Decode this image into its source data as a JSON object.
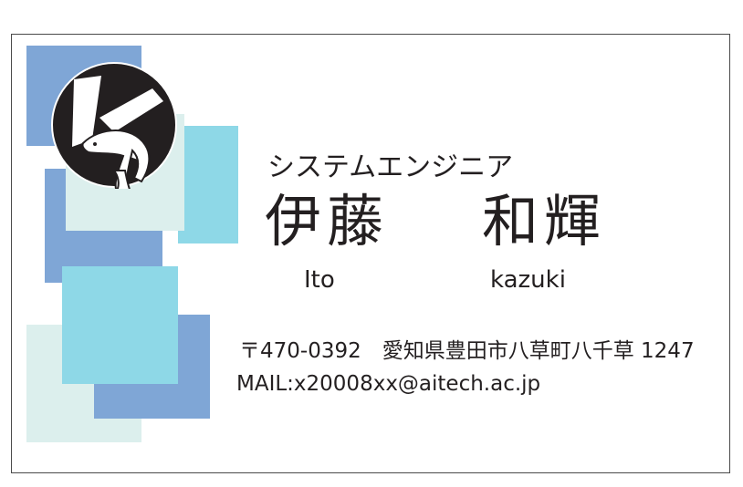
{
  "card": {
    "job_title": "システムエンジニア",
    "family_name": "伊藤",
    "given_name": "和輝",
    "family_name_romaji": "Ito",
    "given_name_romaji": "kazuki",
    "address": "〒470-0392　愛知県豊田市八草町八千草 1247",
    "mail": "MAIL:x20008xx@aitech.ac.jp"
  },
  "logo": {
    "icon": "dolphin-k-logo-icon"
  },
  "colors": {
    "blue": "#7fa6d6",
    "cyan": "#8ed8e7",
    "pale": "#dcefed",
    "text": "#231f20"
  }
}
